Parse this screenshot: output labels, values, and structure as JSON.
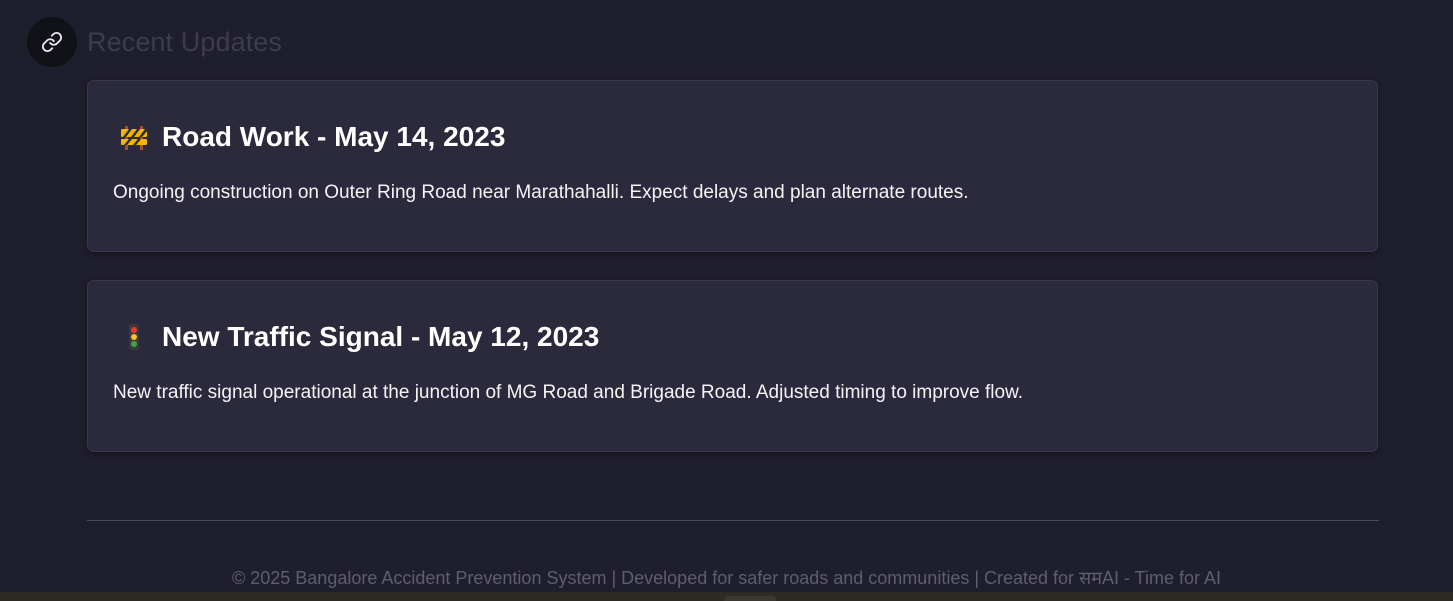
{
  "section": {
    "title": "Recent Updates",
    "link_icon": "link-icon"
  },
  "updates": [
    {
      "icon": "construction-barrier-icon",
      "title": "Road Work - May 14, 2023",
      "text": "Ongoing construction on Outer Ring Road near Marathahalli. Expect delays and plan alternate routes."
    },
    {
      "icon": "traffic-light-icon",
      "title": "New Traffic Signal - May 12, 2023",
      "text": "New traffic signal operational at the junction of MG Road and Brigade Road. Adjusted timing to improve flow."
    }
  ],
  "footer": {
    "text": "© 2025 Bangalore Accident Prevention System | Developed for safer roads and communities | Created for समAI - Time for AI"
  },
  "colors": {
    "background": "#1f1e2d",
    "card_background": "#2b2a3c",
    "title_muted": "#3d3c4b",
    "footer_text": "#5f5e6c"
  }
}
